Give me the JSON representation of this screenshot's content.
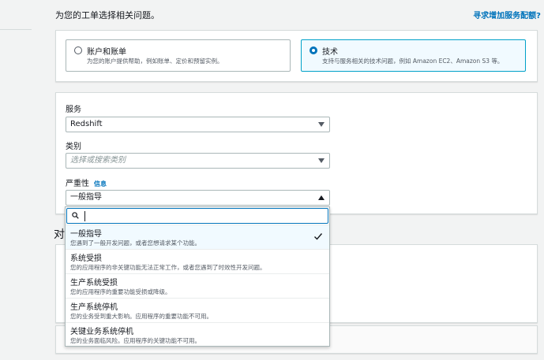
{
  "header": {
    "heading": "为您的工单选择相关问题。",
    "quota_link": "寻求增加服务配额?"
  },
  "case_type": {
    "options": [
      {
        "title": "账户和账单",
        "desc": "为您的账户提供帮助，例如账单、定价和预留实例。",
        "selected": false
      },
      {
        "title": "技术",
        "desc": "支持与服务相关的技术问题，例如 Amazon EC2、Amazon S3 等。",
        "selected": true
      }
    ]
  },
  "form": {
    "service_label": "服务",
    "service_value": "Redshift",
    "category_label": "类别",
    "category_placeholder": "选择或搜索类别",
    "severity_label": "严重性",
    "severity_info": "信息",
    "severity_value": "一般指导"
  },
  "partial_heading": "对",
  "dropdown": {
    "options": [
      {
        "title": "一般指导",
        "desc": "您遇到了一般开发问题，或者您想请求某个功能。",
        "selected": true
      },
      {
        "title": "系统受损",
        "desc": "您的应用程序的非关键功能无法正常工作，或者您遇到了时效性开发问题。",
        "selected": false
      },
      {
        "title": "生产系统受损",
        "desc": "您的应用程序的重要功能受损或降级。",
        "selected": false
      },
      {
        "title": "生产系统停机",
        "desc": "您的业务受到重大影响。应用程序的重要功能不可用。",
        "selected": false
      },
      {
        "title": "关键业务系统停机",
        "desc": "您的业务面临风险。应用程序的关键功能不可用。",
        "selected": false
      }
    ]
  },
  "colors": {
    "link": "#0073bb",
    "selected_bg": "#f1faff",
    "selected_border": "#00a1c9"
  }
}
